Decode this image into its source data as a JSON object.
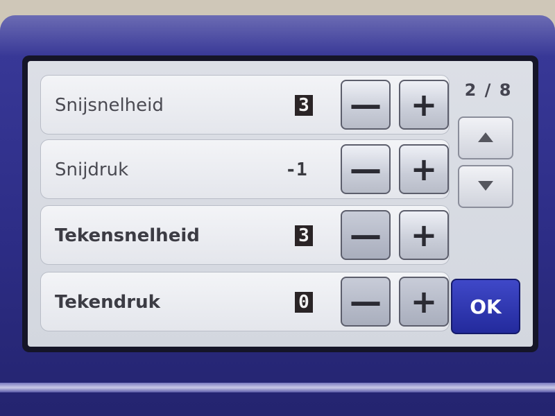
{
  "pager": {
    "current": "2 / 8"
  },
  "settings": [
    {
      "label": "Snijsnelheid",
      "value": "3"
    },
    {
      "label": "Snijdruk",
      "value": "-1"
    },
    {
      "label": "Tekensnelheid",
      "value": "3"
    },
    {
      "label": "Tekendruk",
      "value": "0"
    }
  ],
  "buttons": {
    "minus": "—",
    "plus": "+",
    "ok": "OK"
  },
  "icons": {
    "up": "arrow-up-icon",
    "down": "arrow-down-icon"
  },
  "colors": {
    "bezel": "#2d2d86",
    "ok_button": "#2a31a8",
    "value_box": "#2a2426"
  }
}
